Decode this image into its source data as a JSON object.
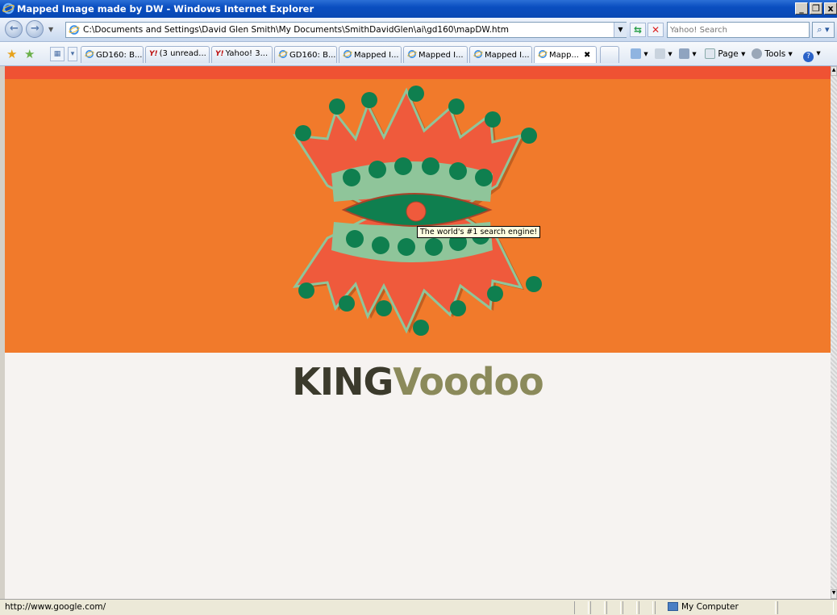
{
  "window": {
    "title": "Mapped Image made by DW - Windows Internet Explorer",
    "minimize": "_",
    "maximize": "8",
    "close": "x"
  },
  "address": {
    "url": "C:\\Documents and Settings\\David Glen Smith\\My Documents\\SmithDavidGlen\\ai\\gd160\\mapDW.htm",
    "search_placeholder": "Yahoo! Search"
  },
  "tabs": [
    {
      "label": "GD160: B...",
      "icon": "ie-icon"
    },
    {
      "label": "(3 unread...",
      "icon": "yahoo-icon"
    },
    {
      "label": "Yahoo! 3...",
      "icon": "yahoo-icon"
    },
    {
      "label": "GD160: B...",
      "icon": "ie-icon"
    },
    {
      "label": "Mapped I...",
      "icon": "ie-icon"
    },
    {
      "label": "Mapped I...",
      "icon": "ie-icon"
    },
    {
      "label": "Mapped I...",
      "icon": "ie-icon"
    },
    {
      "label": "Mapp...",
      "icon": "ie-icon",
      "active": true
    }
  ],
  "commands": {
    "page": "Page",
    "tools": "Tools"
  },
  "page": {
    "wordmark_king": "KING",
    "wordmark_voodoo": "Voodoo",
    "tooltip": "The world's #1 search engine!",
    "colors": {
      "top_stripe": "#ef5233",
      "banner": "#f17a2b",
      "crown_red": "#ef5a3c",
      "crown_green_light": "#8fc59a",
      "crown_green_dark": "#0f7f4f"
    }
  },
  "status": {
    "url": "http://www.google.com/",
    "zone": "My Computer"
  }
}
